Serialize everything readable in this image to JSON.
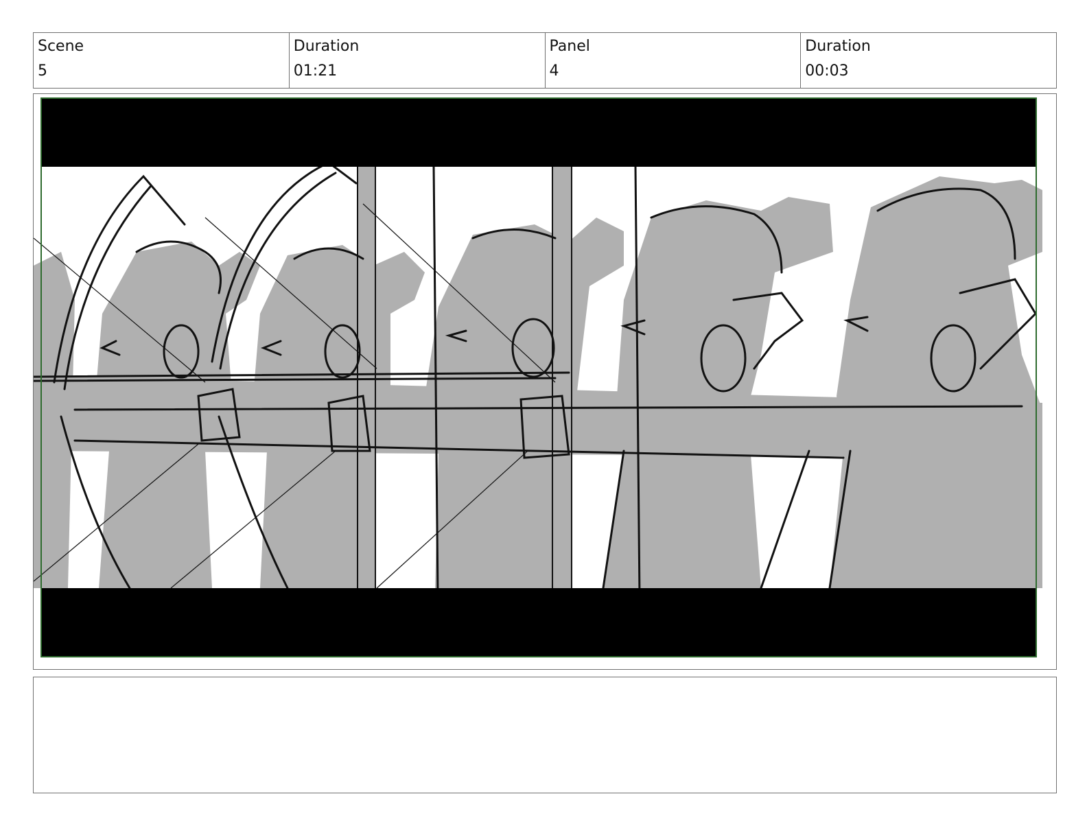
{
  "header": {
    "scene_label": "Scene",
    "scene_value": "5",
    "scene_duration_label": "Duration",
    "scene_duration_value": "01:21",
    "panel_label": "Panel",
    "panel_value": "4",
    "panel_duration_label": "Duration",
    "panel_duration_value": "00:03"
  },
  "panel": {
    "description": "",
    "colors": {
      "letterbox": "#000000",
      "fill": "#b0b0b0",
      "line": "#111111",
      "frame": "#2e6b2e"
    }
  },
  "notes": {
    "text": ""
  }
}
